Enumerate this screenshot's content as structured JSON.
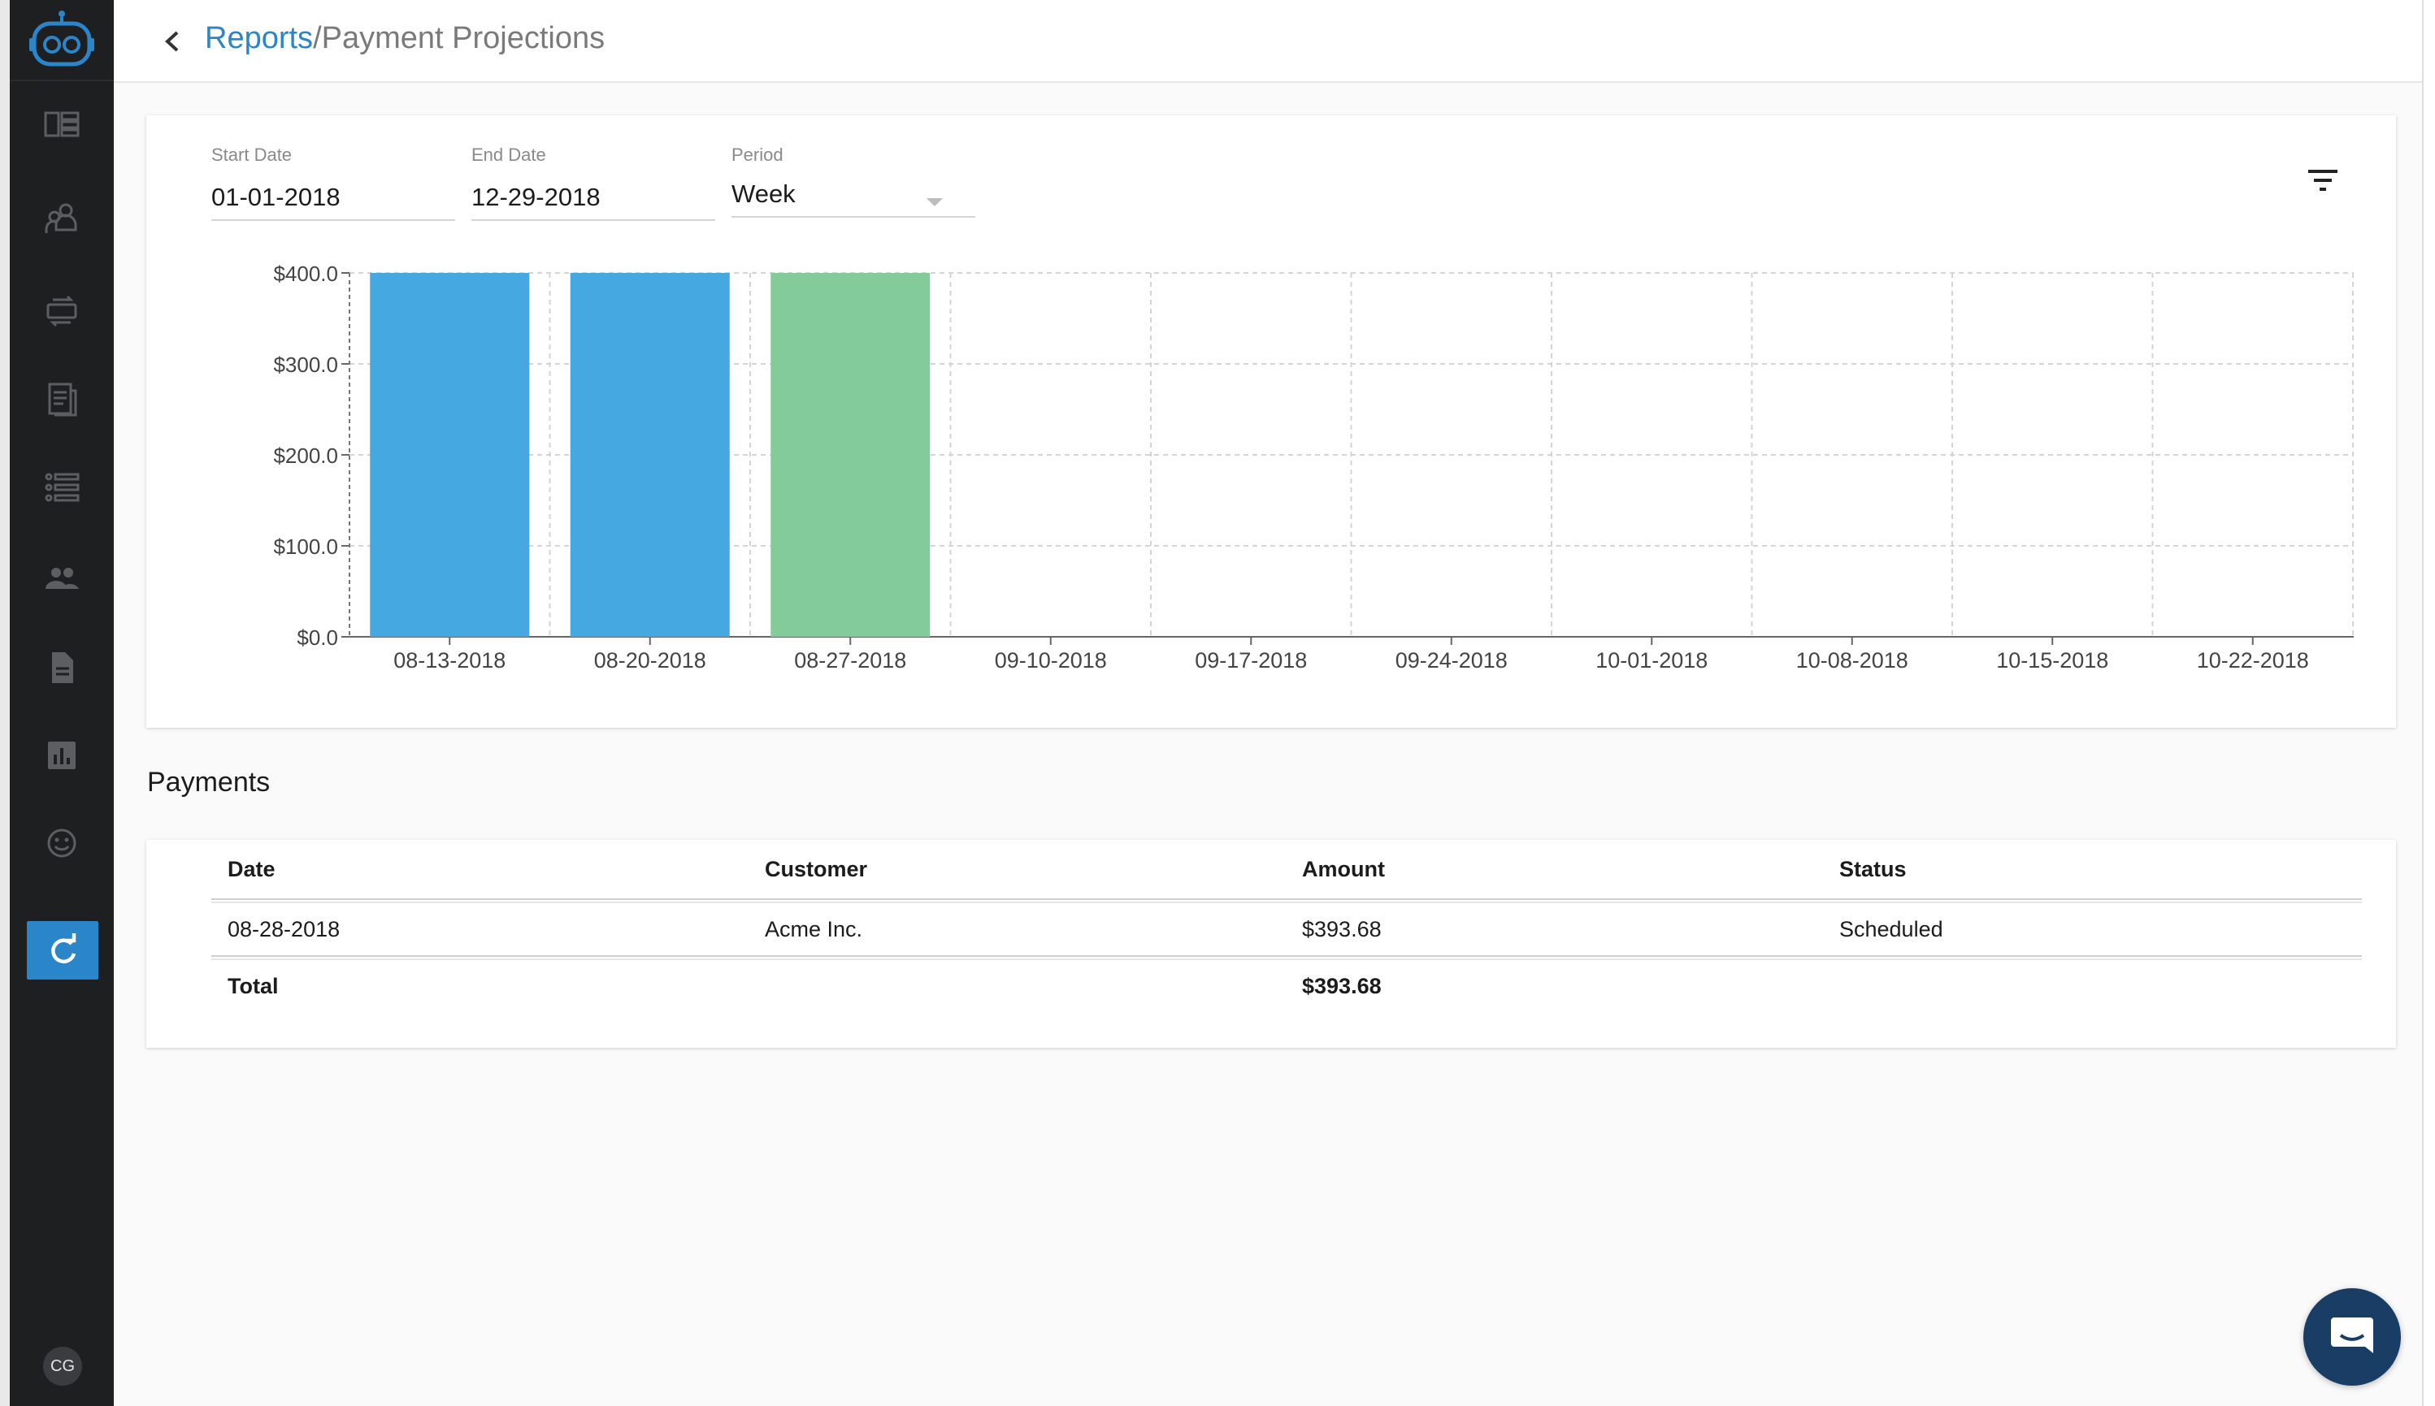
{
  "header": {
    "breadcrumb_link": "Reports",
    "breadcrumb_separator": "/",
    "breadcrumb_current": "Payment Projections"
  },
  "sidebar": {
    "items": [
      {
        "icon": "dashboard-icon"
      },
      {
        "icon": "contacts-icon"
      },
      {
        "icon": "payment-transfer-icon"
      },
      {
        "icon": "invoice-icon"
      },
      {
        "icon": "list-icon"
      },
      {
        "icon": "people-icon"
      },
      {
        "icon": "document-icon"
      },
      {
        "icon": "bar-chart-icon"
      },
      {
        "icon": "smiley-icon"
      }
    ],
    "refresh_icon": "refresh-icon",
    "avatar_initials": "CG"
  },
  "filters": {
    "start_date_label": "Start Date",
    "start_date": "01-01-2018",
    "end_date_label": "End Date",
    "end_date": "12-29-2018",
    "period_label": "Period",
    "period": "Week"
  },
  "colors": {
    "accent": "#2a86c8",
    "bar_blue": "#46a8e0",
    "bar_green": "#84cb9c",
    "sidebar_bg": "#1e1f21"
  },
  "chart_data": {
    "type": "bar",
    "categories": [
      "08-13-2018",
      "08-20-2018",
      "08-27-2018",
      "09-10-2018",
      "09-17-2018",
      "09-24-2018",
      "10-01-2018",
      "10-08-2018",
      "10-15-2018",
      "10-22-2018"
    ],
    "values": [
      400,
      400,
      400,
      0,
      0,
      0,
      0,
      0,
      0,
      0
    ],
    "bar_colors": [
      "#46a8e0",
      "#46a8e0",
      "#84cb9c",
      "#46a8e0",
      "#46a8e0",
      "#46a8e0",
      "#46a8e0",
      "#46a8e0",
      "#46a8e0",
      "#46a8e0"
    ],
    "y_ticks": [
      0,
      100,
      200,
      300,
      400
    ],
    "y_tick_labels": [
      "$0.0",
      "$100.0",
      "$200.0",
      "$300.0",
      "$400.0"
    ],
    "ylim": [
      0,
      400
    ],
    "grid": true
  },
  "payments": {
    "title": "Payments",
    "columns": [
      "Date",
      "Customer",
      "Amount",
      "Status"
    ],
    "rows": [
      {
        "date": "08-28-2018",
        "customer": "Acme Inc.",
        "amount": "$393.68",
        "status": "Scheduled"
      }
    ],
    "total_label": "Total",
    "total_amount": "$393.68"
  }
}
